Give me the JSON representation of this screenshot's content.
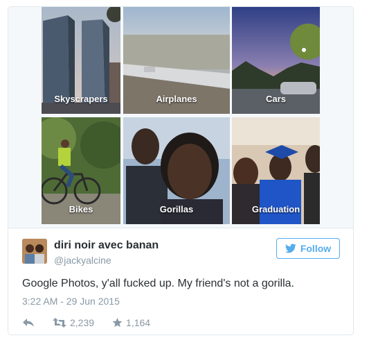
{
  "tiles": [
    {
      "label": "Skyscrapers"
    },
    {
      "label": "Airplanes"
    },
    {
      "label": "Cars"
    },
    {
      "label": "Bikes"
    },
    {
      "label": "Gorillas"
    },
    {
      "label": "Graduation"
    }
  ],
  "tweet": {
    "display_name": "diri noir avec banan",
    "handle": "@jackyalcine",
    "follow_label": "Follow",
    "text": "Google Photos, y'all fucked up. My friend's not a gorilla.",
    "timestamp": "3:22 AM - 29 Jun 2015",
    "retweets": "2,239",
    "likes": "1,164"
  },
  "colors": {
    "accent": "#55acee",
    "text": "#292f33",
    "muted": "#8899a6",
    "border": "#e1e8ed"
  },
  "icons": [
    "twitter-bird-icon",
    "reply-icon",
    "retweet-icon",
    "star-icon"
  ]
}
